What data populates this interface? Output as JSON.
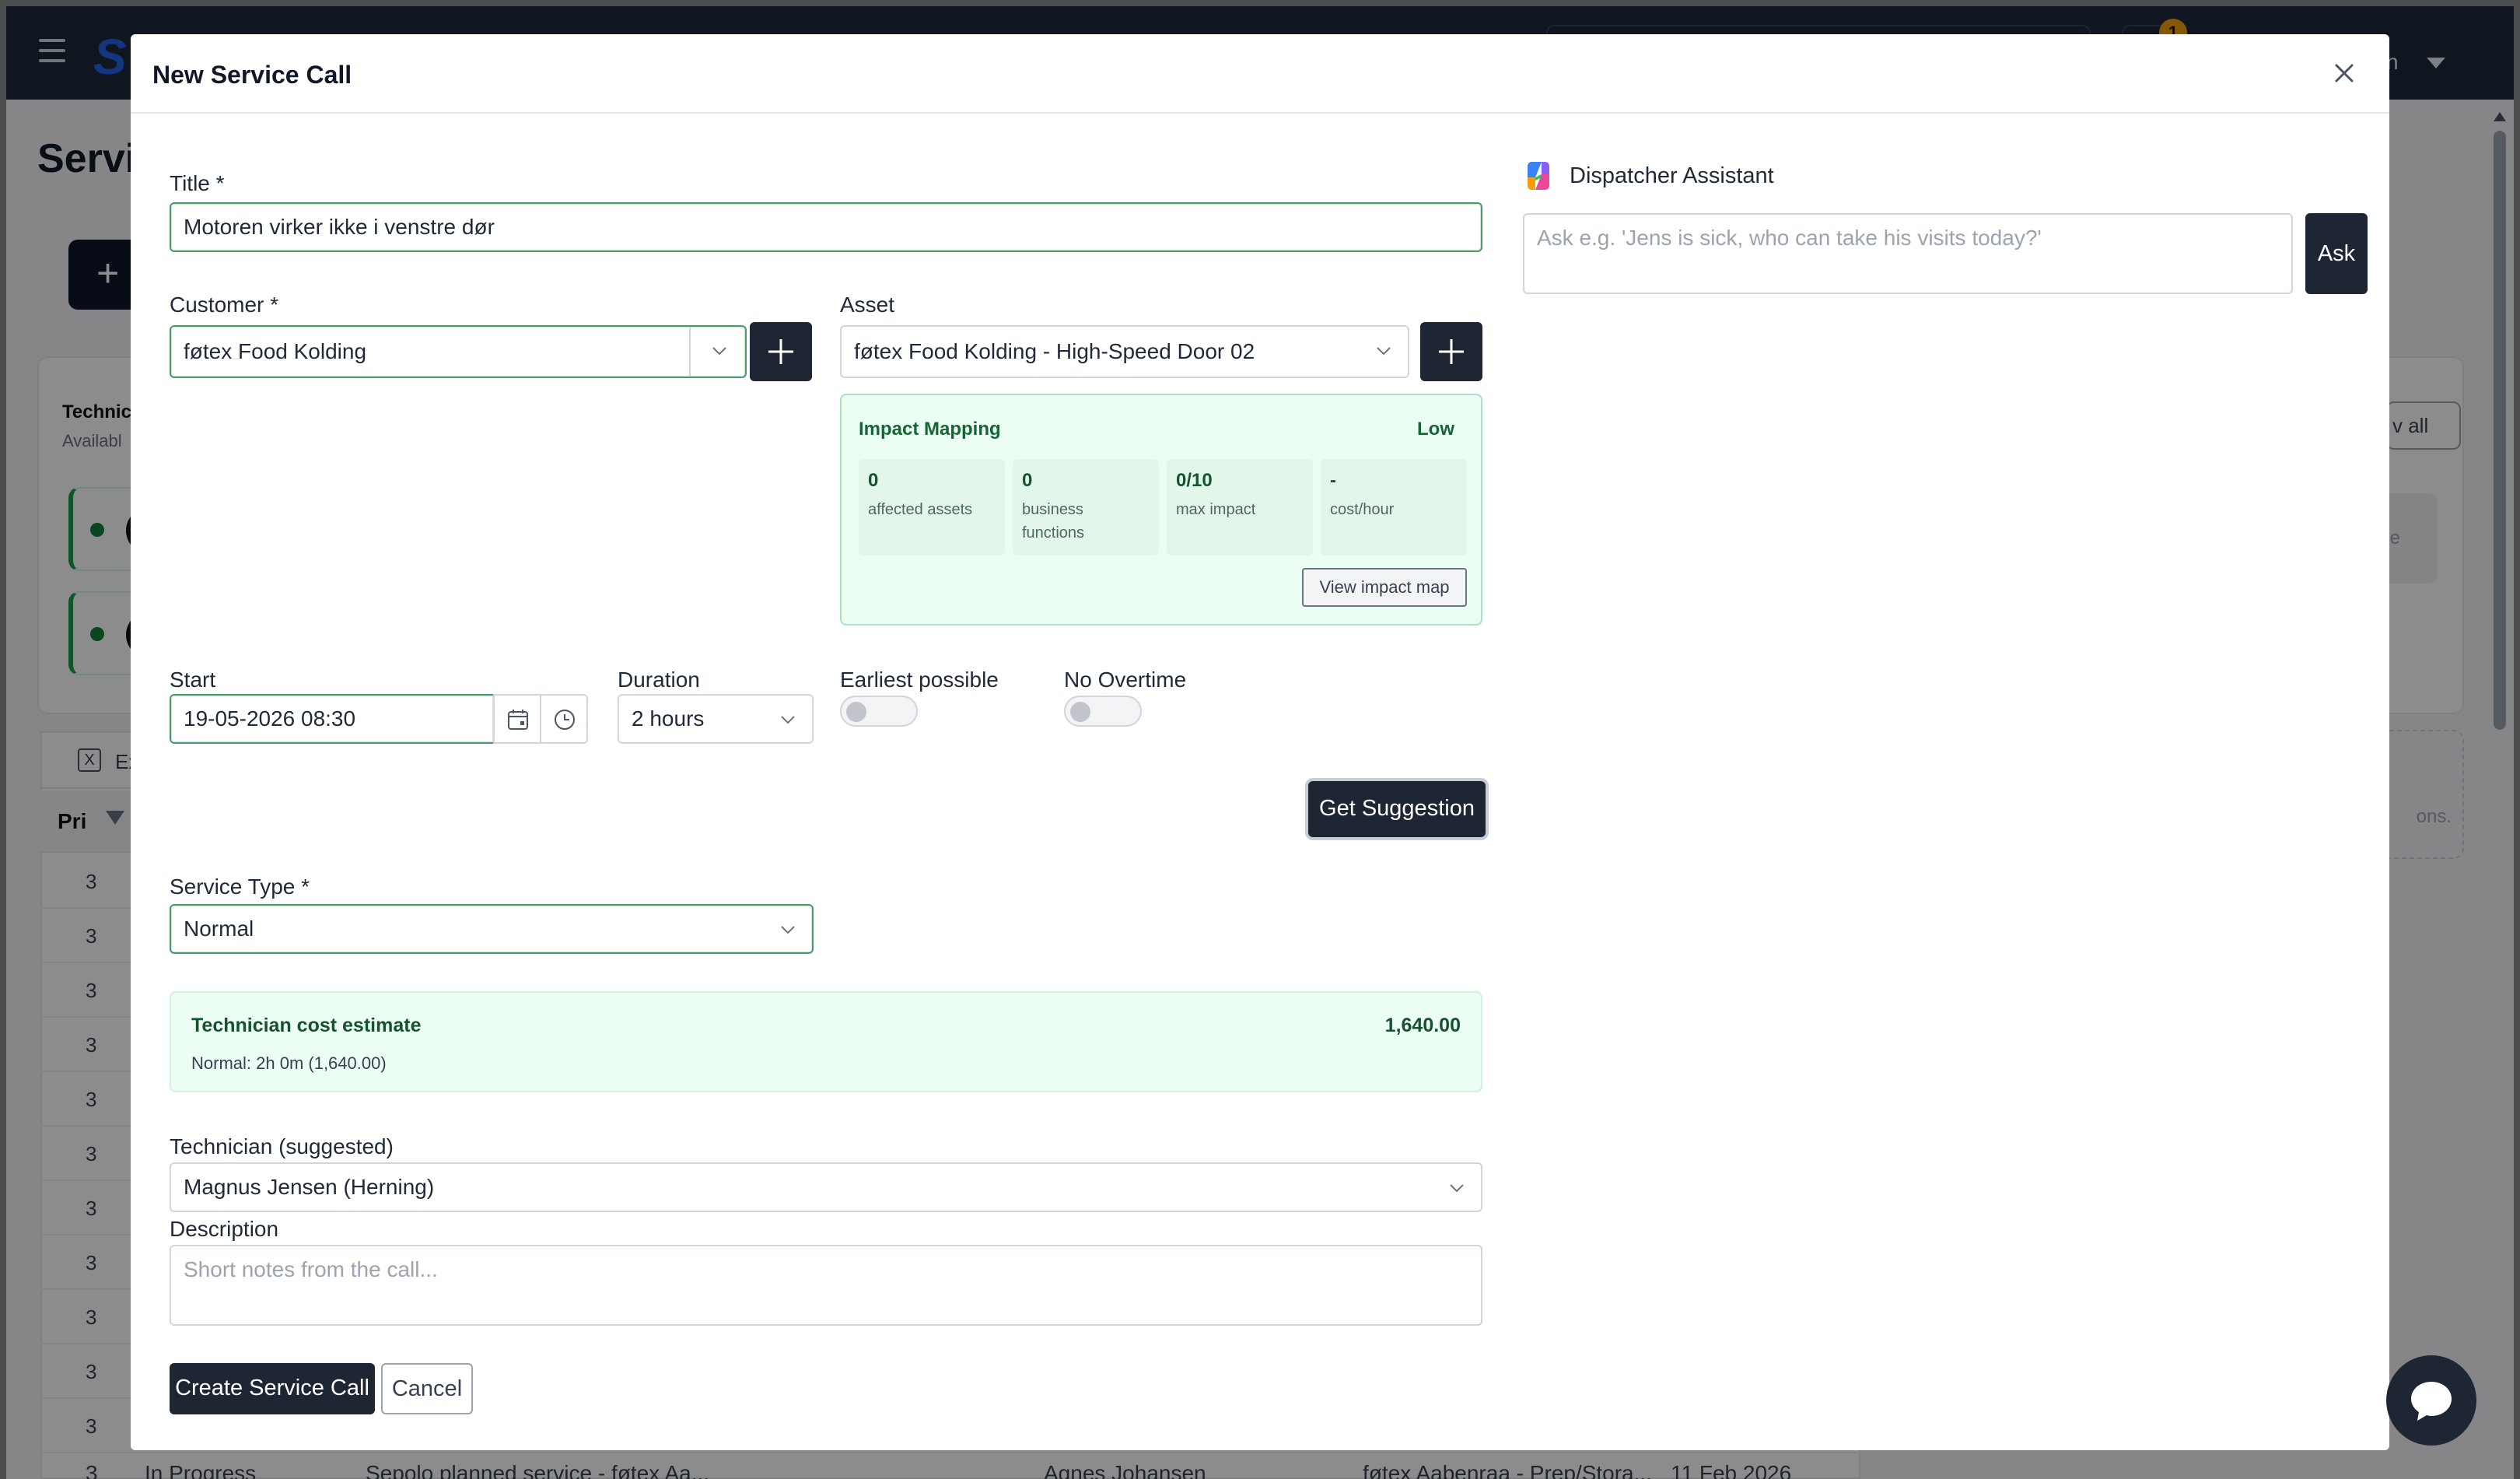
{
  "background": {
    "page_title": "Servic",
    "brand_initial": "S",
    "notification_count": "1",
    "user_label": "n",
    "add_label": "+",
    "panel_title": "Technici",
    "panel_sub": "Availabl",
    "view_all": "v all",
    "side_card_text": "ble",
    "dashed_text": "ons.",
    "export_label": "Ex",
    "col_priority": "Pri",
    "rows_priority": [
      "3",
      "3",
      "3",
      "3",
      "3",
      "3",
      "3",
      "3",
      "3",
      "3",
      "3"
    ],
    "last_row": {
      "priority": "3",
      "status": "In Progress",
      "title": "Sepolo planned service - føtex Aa...",
      "technician": "Agnes Johansen",
      "location": "føtex Aabenraa - Prep/Stora...",
      "date": "11 Feb 2026"
    }
  },
  "modal": {
    "title": "New Service Call",
    "title_field": {
      "label": "Title *",
      "value": "Motoren virker ikke i venstre dør"
    },
    "customer": {
      "label": "Customer *",
      "value": "føtex Food Kolding"
    },
    "asset": {
      "label": "Asset",
      "value": "føtex Food Kolding - High-Speed Door 02"
    },
    "impact": {
      "title": "Impact Mapping",
      "level": "Low",
      "metrics": [
        {
          "value": "0",
          "label": "affected assets"
        },
        {
          "value": "0",
          "label": "business functions"
        },
        {
          "value": "0/10",
          "label": "max impact"
        },
        {
          "value": "-",
          "label": "cost/hour"
        }
      ],
      "link": "View impact map"
    },
    "start": {
      "label": "Start",
      "value": "19-05-2026 08:30"
    },
    "duration": {
      "label": "Duration",
      "value": "2 hours"
    },
    "earliest": {
      "label": "Earliest possible",
      "on": false
    },
    "no_overtime": {
      "label": "No Overtime",
      "on": false
    },
    "suggest_button": "Get Suggestion",
    "service_type": {
      "label": "Service Type *",
      "value": "Normal"
    },
    "cost": {
      "title": "Technician cost estimate",
      "value": "1,640.00",
      "detail": "Normal: 2h 0m (1,640.00)"
    },
    "technician": {
      "label": "Technician (suggested)",
      "value": "Magnus Jensen (Herning)"
    },
    "description": {
      "label": "Description",
      "placeholder": "Short notes from the call..."
    },
    "create_button": "Create Service Call",
    "cancel_button": "Cancel",
    "assistant": {
      "title": "Dispatcher Assistant",
      "placeholder": "Ask e.g. 'Jens is sick, who can take his visits today?'",
      "ask_button": "Ask"
    }
  },
  "colors": {
    "primary_dark": "#1e2633",
    "success_bg": "#ecfdf3",
    "success_text": "#166534",
    "input_focus": "#4a9a6a"
  }
}
